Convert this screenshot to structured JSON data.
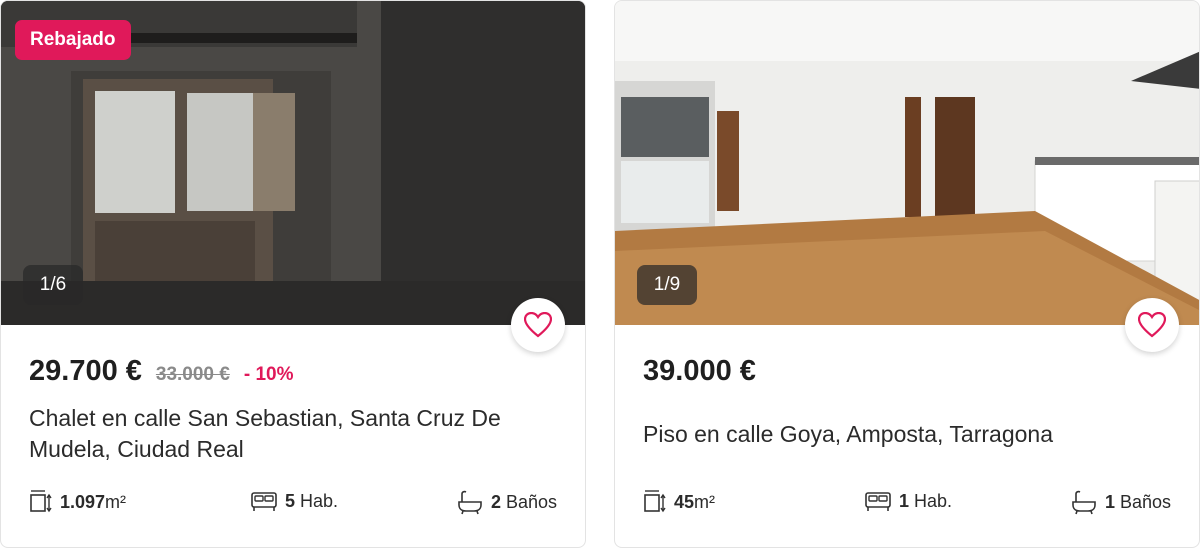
{
  "cards": [
    {
      "badge": "Rebajado",
      "photo_counter": "1/6",
      "price": "29.700 €",
      "old_price": "33.000 €",
      "discount": "- 10%",
      "title": "Chalet en calle San Sebastian, Santa Cruz De Mudela, Ciudad Real",
      "area_value": "1.097",
      "area_unit": "m²",
      "rooms_value": "5",
      "rooms_label": "Hab.",
      "baths_value": "2",
      "baths_label": "Baños",
      "favorite_icon": "heart-outline-icon"
    },
    {
      "photo_counter": "1/9",
      "price": "39.000 €",
      "title": "Piso en calle Goya, Amposta, Tarragona",
      "area_value": "45",
      "area_unit": "m²",
      "rooms_value": "1",
      "rooms_label": "Hab.",
      "baths_value": "1",
      "baths_label": "Baños",
      "favorite_icon": "heart-outline-icon"
    }
  ],
  "colors": {
    "accent": "#e0195a",
    "price_text": "#1f1f1f",
    "old_price_text": "#8a8a8a"
  }
}
